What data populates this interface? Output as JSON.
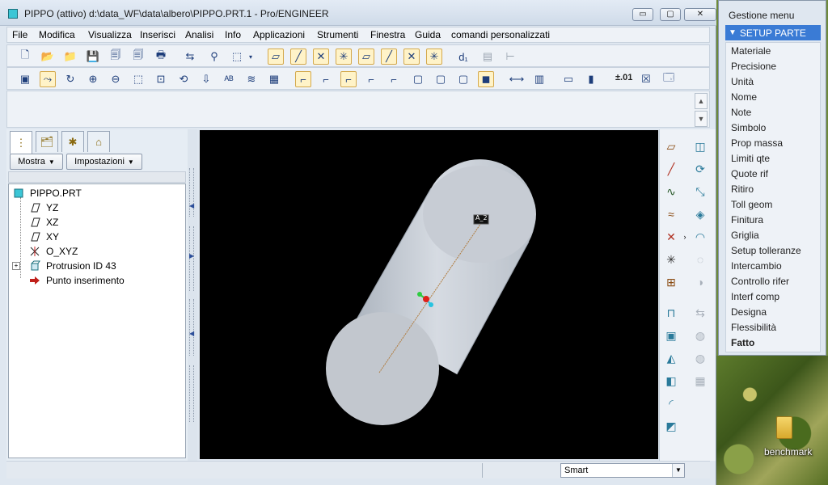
{
  "window": {
    "title": "PIPPO (attivo)  d:\\data_WF\\data\\albero\\PIPPO.PRT.1 - Pro/ENGINEER",
    "minimize": "▭",
    "maximize": "▢",
    "close": "✕"
  },
  "menubar": {
    "items": [
      "File",
      "Modifica",
      "Visualizza",
      "Inserisci",
      "Analisi",
      "Info",
      "Applicazioni",
      "Strumenti",
      "Finestra",
      "Guida",
      "comandi personalizzati"
    ]
  },
  "toolbar2": {
    "precision_label": "±.01"
  },
  "navigator": {
    "show_button": "Mostra",
    "settings_button": "Impostazioni",
    "tree": {
      "root": "PIPPO.PRT",
      "items": [
        "YZ",
        "XZ",
        "XY",
        "O_XYZ",
        "Protrusion ID 43",
        "Punto inserimento"
      ]
    }
  },
  "viewport": {
    "axis_label": "A_2",
    "colors": {
      "background": "#000000",
      "part": "#c9ced6",
      "axis": "#b07a3a"
    }
  },
  "statusbar": {
    "filter_value": "Smart"
  },
  "menu_manager": {
    "title": "Gestione menu",
    "header": "SETUP PARTE",
    "items": [
      "Materiale",
      "Precisione",
      "Unità",
      "Nome",
      "Note",
      "Simbolo",
      "Prop massa",
      "Limiti qte",
      "Quote rif",
      "Ritiro",
      "Toll geom",
      "Finitura",
      "Griglia",
      "Setup tolleranze",
      "Intercambio",
      "Controllo rifer",
      "Interf comp",
      "Designa",
      "Flessibilità",
      "Fatto"
    ]
  },
  "desktop": {
    "folder_label": "benchmark"
  }
}
